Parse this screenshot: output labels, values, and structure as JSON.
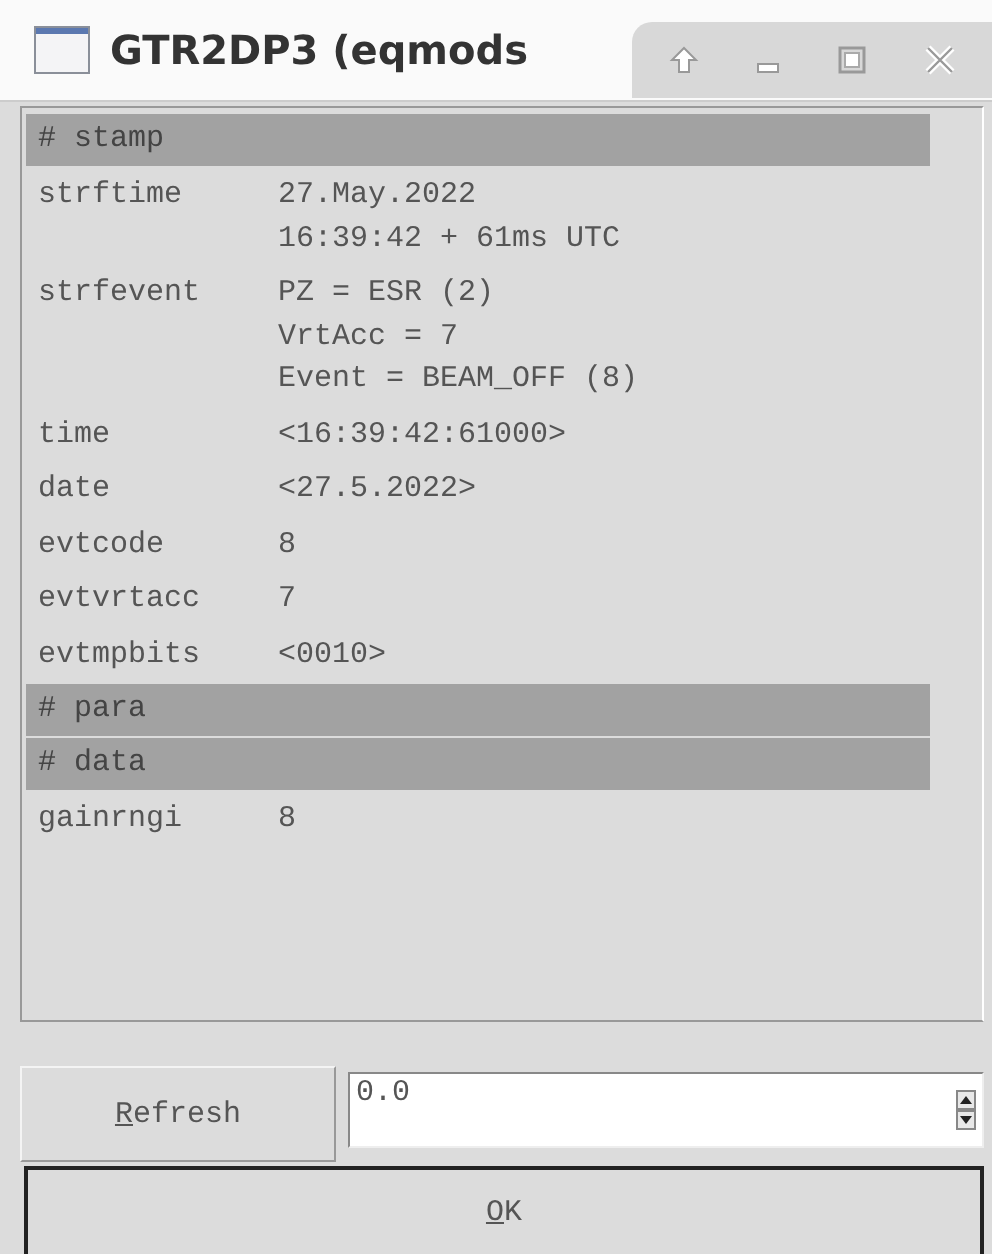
{
  "window": {
    "title": "GTR2DP3 (eqmods"
  },
  "rows": [
    {
      "kind": "header",
      "label": "# stamp"
    },
    {
      "kind": "field",
      "label": "strftime",
      "lines": [
        "27.May.2022",
        "16:39:42 + 61ms UTC"
      ]
    },
    {
      "kind": "field",
      "label": "strfevent",
      "lines": [
        "PZ = ESR (2)",
        "VrtAcc = 7",
        "Event = BEAM_OFF (8)"
      ]
    },
    {
      "kind": "field",
      "label": "time",
      "lines": [
        "<16:39:42:61000>"
      ]
    },
    {
      "kind": "field",
      "label": "date",
      "lines": [
        "<27.5.2022>"
      ]
    },
    {
      "kind": "field",
      "label": "evtcode",
      "lines": [
        "8"
      ]
    },
    {
      "kind": "field",
      "label": "evtvrtacc",
      "lines": [
        "7"
      ]
    },
    {
      "kind": "field",
      "label": "evtmpbits",
      "lines": [
        "<0010>"
      ]
    },
    {
      "kind": "header",
      "label": "# para"
    },
    {
      "kind": "header",
      "label": "# data"
    },
    {
      "kind": "field",
      "label": "gainrngi",
      "lines": [
        "8"
      ]
    }
  ],
  "refresh_button": "Refresh",
  "spin_field": {
    "value": "0.0"
  },
  "ok_button": "OK"
}
